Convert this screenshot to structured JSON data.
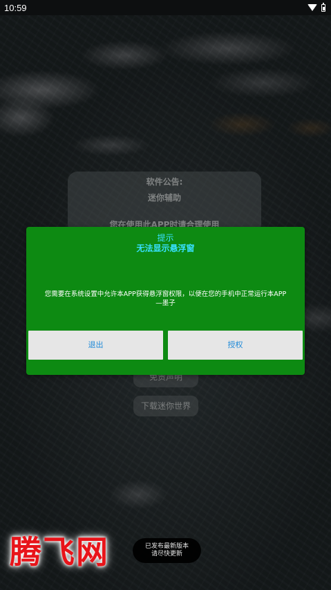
{
  "status_bar": {
    "time": "10:59",
    "icons": [
      "wifi-icon",
      "battery-icon"
    ]
  },
  "announcement": {
    "title": "软件公告:",
    "subtitle": "迷你辅助",
    "line": "您在使用此APP时请合理使用"
  },
  "buttons": {
    "disclaimer": "免责声明",
    "download": "下载迷你世界"
  },
  "dialog": {
    "title": "提示",
    "subtitle": "无法显示悬浮窗",
    "message_line1": "您需要在系统设置中允许本APP获得悬浮窗权限，以便在您的手机中正常运行本APP",
    "message_line2": "—墨子",
    "exit_label": "退出",
    "grant_label": "授权",
    "colors": {
      "background": "#0d8a12",
      "title": "#38e0ff",
      "button_text": "#1f8ad8"
    }
  },
  "toast": {
    "line1": "已发布最新版本",
    "line2": "请尽快更新"
  },
  "watermark": {
    "text": "腾飞网",
    "color": "#e8141a"
  }
}
